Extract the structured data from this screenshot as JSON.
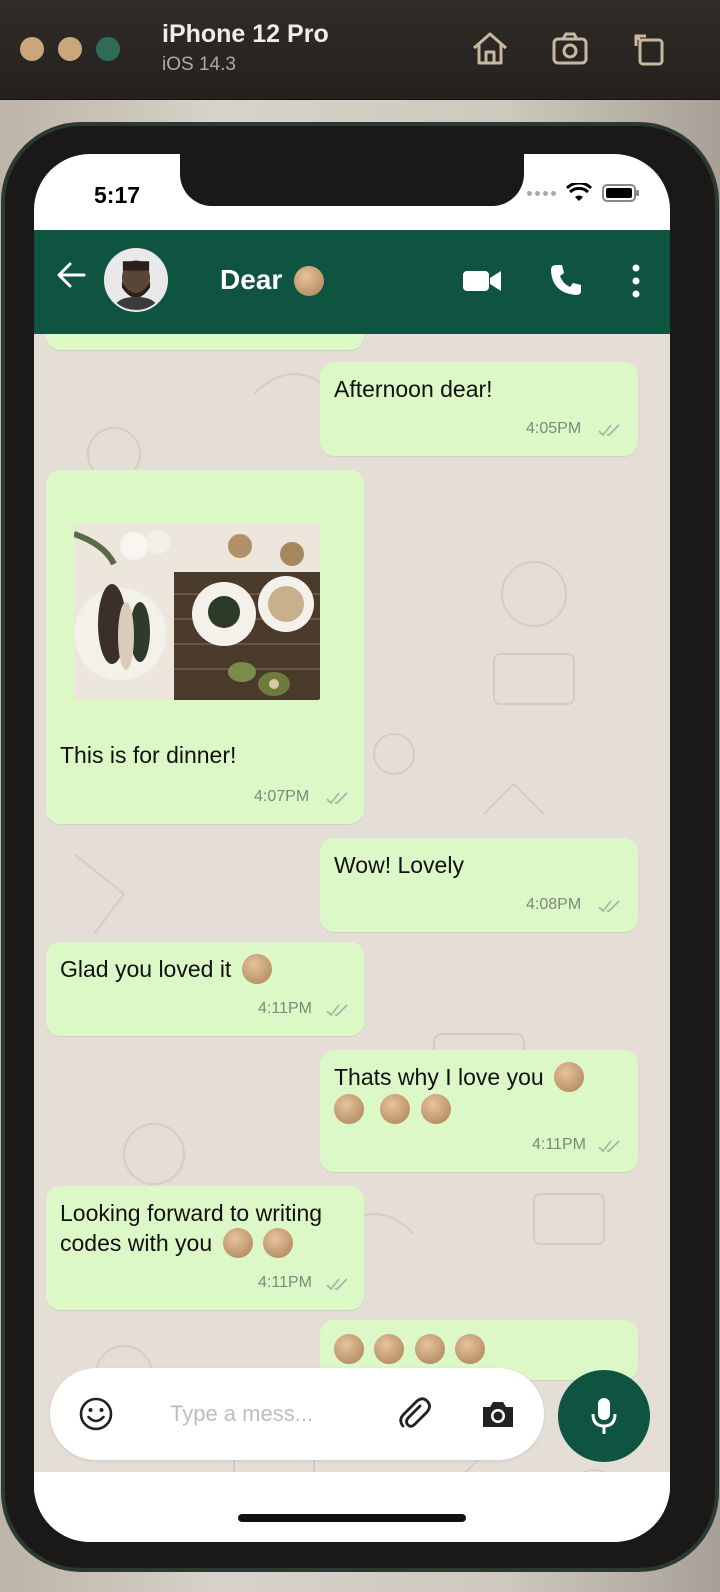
{
  "simulator": {
    "device": "iPhone 12 Pro",
    "os": "iOS 14.3",
    "icons": [
      "home-icon",
      "screenshot-icon",
      "rotate-icon"
    ]
  },
  "status_bar": {
    "time": "5:17"
  },
  "header": {
    "contact_name": "Dear",
    "icons": [
      "back-arrow-icon",
      "video-call-icon",
      "phone-icon",
      "more-vert-icon"
    ],
    "color": "#0f5341"
  },
  "messages": [
    {
      "text": "Afternoon dear!",
      "time": "4:05PM",
      "direction": "outgoing"
    },
    {
      "text": "This is for dinner!",
      "time": "4:07PM",
      "direction": "incoming",
      "has_image": true
    },
    {
      "text": "Wow! Lovely",
      "time": "4:08PM",
      "direction": "outgoing"
    },
    {
      "text": "Glad you loved it",
      "time": "4:11PM",
      "direction": "incoming"
    },
    {
      "text": "Thats why I love you",
      "time": "4:11PM",
      "direction": "outgoing"
    },
    {
      "text_line1": "Looking forward to writing",
      "text_line2": "codes with you",
      "time": "4:11PM",
      "direction": "incoming"
    }
  ],
  "input": {
    "placeholder": "Type a mess..."
  },
  "colors": {
    "bubble": "#dcf8c6",
    "chat_bg": "#e5ded6",
    "accent": "#0f5341"
  }
}
